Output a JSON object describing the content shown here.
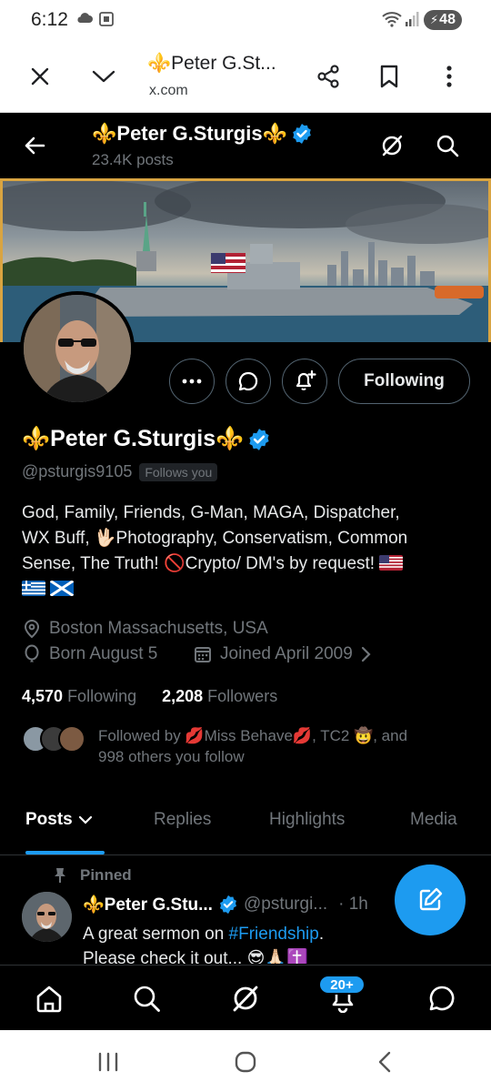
{
  "status_bar": {
    "time": "6:12",
    "battery": "48"
  },
  "browser": {
    "page_title": "⚜️Peter G.St...",
    "domain": "x.com"
  },
  "header": {
    "name": "⚜️Peter G.Sturgis⚜️",
    "posts": "23.4K posts"
  },
  "profile": {
    "name": "⚜️Peter G.Sturgis⚜️",
    "handle": "@psturgis9105",
    "follows_you": "Follows you",
    "following_button": "Following",
    "bio_line1": "God, Family, Friends, G-Man, MAGA, Dispatcher,",
    "bio_line2": "WX Buff, 🖖🏻Photography, Conservatism, Common",
    "bio_line3": "Sense, The Truth! 🚫Crypto/ DM's by request!",
    "location": "Boston Massachusetts, USA",
    "born": "Born August 5",
    "joined": "Joined April 2009",
    "following_count": "4,570",
    "following_label": "Following",
    "followers_count": "2,208",
    "followers_label": "Followers",
    "followed_by_line1": "Followed by 💋Miss Behave💋, TC2 🤠, and",
    "followed_by_line2": "998 others you follow"
  },
  "tabs": [
    "Posts",
    "Replies",
    "Highlights",
    "Media"
  ],
  "pinned_post": {
    "pinned_label": "Pinned",
    "author": "⚜️Peter G.Stu...",
    "handle": "@psturgi...",
    "time": "· 1h",
    "text_before": "A great sermon on ",
    "hashtag": "#Friendship",
    "text_after": ".",
    "text_line2": "Please check it out... 😎🙏🏻✝️"
  },
  "bottom_nav": {
    "notifications_badge": "20+"
  },
  "colors": {
    "accent": "#1d9bf0",
    "background": "#000000",
    "secondary_text": "#71767b"
  }
}
